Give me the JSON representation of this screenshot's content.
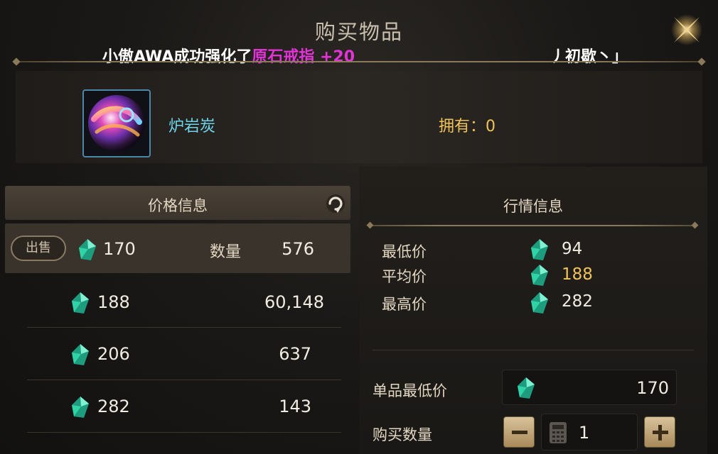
{
  "dialog": {
    "title": "购买物品"
  },
  "ticker": {
    "prefix": "小傲AWA成功强化了",
    "highlight": "原石戒指 +20",
    "suffix": "丿初歇丶」"
  },
  "item": {
    "name": "炉岩炭",
    "owned_label": "拥有：0"
  },
  "price_panel": {
    "header": "价格信息",
    "sell_button": "出售",
    "quantity_label": "数量",
    "rows": [
      {
        "price": "170",
        "quantity": "576"
      },
      {
        "price": "188",
        "quantity": "60,148"
      },
      {
        "price": "206",
        "quantity": "637"
      },
      {
        "price": "282",
        "quantity": "143"
      }
    ]
  },
  "market_panel": {
    "header": "行情信息",
    "stats": [
      {
        "label": "最低价",
        "value": "94"
      },
      {
        "label": "平均价",
        "value": "188"
      },
      {
        "label": "最高价",
        "value": "282"
      }
    ]
  },
  "purchase_form": {
    "unit_price_label": "单品最低价",
    "unit_price_value": "170",
    "quantity_label": "购买数量",
    "quantity_value": "1"
  },
  "colors": {
    "highlight": "#e234d6",
    "item_name": "#6fd3ea",
    "owned": "#f0c35a",
    "average_value": "#f0c35a",
    "gem": "#2fd3a6"
  }
}
